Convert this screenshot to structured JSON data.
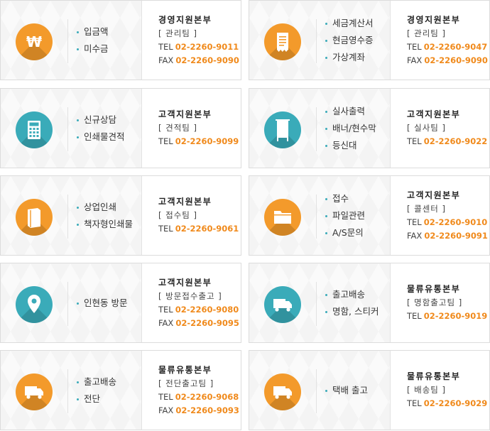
{
  "colors": {
    "orange": "#f39a2b",
    "teal": "#3aabb9",
    "number": "#f08a1c"
  },
  "cards": [
    {
      "icon": "won-icon",
      "color": "orange",
      "services": [
        "입금액",
        "미수금"
      ],
      "dept": "경영지원본부",
      "team": "[ 관리팀 ]",
      "tel_label": "TEL",
      "tel": "02-2260-9011",
      "fax_label": "FAX",
      "fax": "02-2260-9090"
    },
    {
      "icon": "receipt-icon",
      "color": "orange",
      "services": [
        "세금계산서",
        "현금영수증",
        "가상계좌"
      ],
      "dept": "경영지원본부",
      "team": "[ 관리팀 ]",
      "tel_label": "TEL",
      "tel": "02-2260-9047",
      "fax_label": "FAX",
      "fax": "02-2260-9090"
    },
    {
      "icon": "calculator-icon",
      "color": "teal",
      "services": [
        "신규상담",
        "인쇄물견적"
      ],
      "dept": "고객지원본부",
      "team": "[ 견적팀 ]",
      "tel_label": "TEL",
      "tel": "02-2260-9099"
    },
    {
      "icon": "banner-stand-icon",
      "color": "teal",
      "services": [
        "실사출력",
        "배너/현수막",
        "등신대"
      ],
      "dept": "고객지원본부",
      "team": "[ 실사팀 ]",
      "tel_label": "TEL",
      "tel": "02-2260-9022"
    },
    {
      "icon": "book-icon",
      "color": "orange",
      "services": [
        "상업인쇄",
        "책자형인쇄물"
      ],
      "dept": "고객지원본부",
      "team": "[ 접수팀 ]",
      "tel_label": "TEL",
      "tel": "02-2260-9061"
    },
    {
      "icon": "folder-icon",
      "color": "orange",
      "services": [
        "접수",
        "파일관련",
        "A/S문의"
      ],
      "dept": "고객지원본부",
      "team": "[ 콜센터 ]",
      "tel_label": "TEL",
      "tel": "02-2260-9010",
      "fax_label": "FAX",
      "fax": "02-2260-9091"
    },
    {
      "icon": "location-pin-icon",
      "color": "teal",
      "services": [
        "인현동 방문"
      ],
      "dept": "고객지원본부",
      "team": "[ 방문접수출고 ]",
      "tel_label": "TEL",
      "tel": "02-2260-9080",
      "fax_label": "FAX",
      "fax": "02-2260-9095"
    },
    {
      "icon": "truck-icon",
      "color": "teal",
      "services": [
        "출고배송",
        "명함, 스티커"
      ],
      "dept": "물류유통본부",
      "team": "[ 명함출고팀 ]",
      "tel_label": "TEL",
      "tel": "02-2260-9019"
    },
    {
      "icon": "truck-icon",
      "color": "orange",
      "services": [
        "출고배송",
        "전단"
      ],
      "dept": "물류유통본부",
      "team": "[ 전단출고팀 ]",
      "tel_label": "TEL",
      "tel": "02-2260-9068",
      "fax_label": "FAX",
      "fax": "02-2260-9093"
    },
    {
      "icon": "truck-icon",
      "color": "orange",
      "services": [
        "택배 출고"
      ],
      "dept": "물류유통본부",
      "team": "[ 배송팀 ]",
      "tel_label": "TEL",
      "tel": "02-2260-9029"
    }
  ]
}
